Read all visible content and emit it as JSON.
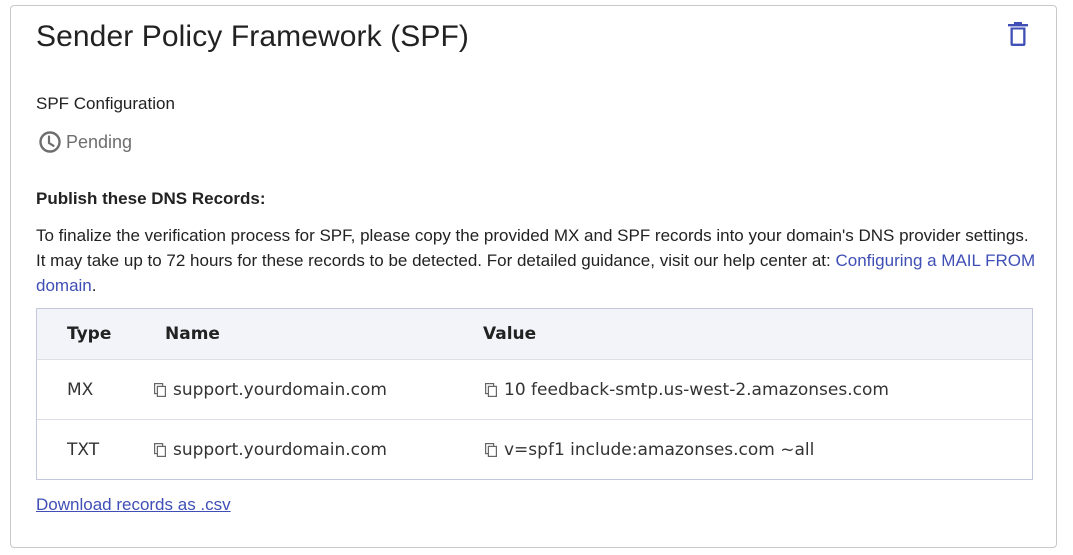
{
  "card": {
    "title": "Sender Policy Framework (SPF)",
    "delete_icon": "trash-icon"
  },
  "config": {
    "label": "SPF Configuration",
    "status": "Pending",
    "status_icon": "clock-icon",
    "status_color": "#6e6e6e"
  },
  "publish": {
    "heading": "Publish these DNS Records:",
    "description": "To finalize the verification process for SPF, please copy the provided MX and SPF records into your domain's DNS provider settings. It may take up to 72 hours for these records to be detected. For detailed guidance, visit our help center at: ",
    "help_link": "Configuring a MAIL FROM domain",
    "trailing": "."
  },
  "table": {
    "headers": [
      "Type",
      "Name",
      "Value"
    ],
    "rows": [
      {
        "type": "MX",
        "name": "support.yourdomain.com",
        "value": "10 feedback-smtp.us-west-2.amazonses.com"
      },
      {
        "type": "TXT",
        "name": "support.yourdomain.com",
        "value": "v=spf1 include:amazonses.com ~all"
      }
    ],
    "copy_icon": "copy-icon"
  },
  "download": {
    "label": "Download records as .csv"
  },
  "colors": {
    "accent": "#3f4fb5",
    "table_header_bg": "#f3f4fa"
  }
}
